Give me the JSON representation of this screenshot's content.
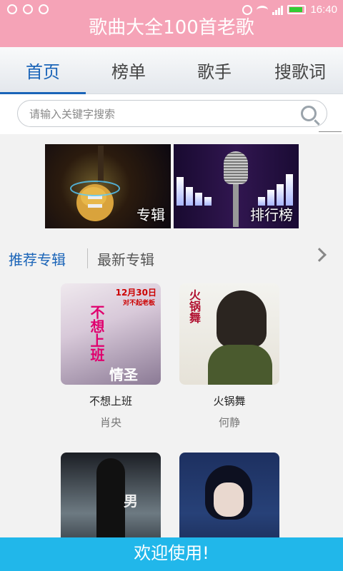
{
  "status_bar": {
    "time": "16:40"
  },
  "app": {
    "title": "歌曲大全100首老歌"
  },
  "tabs": [
    {
      "label": "首页",
      "active": true
    },
    {
      "label": "榜单",
      "active": false
    },
    {
      "label": "歌手",
      "active": false
    },
    {
      "label": "搜歌词",
      "active": false
    }
  ],
  "search": {
    "placeholder": "请输入关键字搜索",
    "value": ""
  },
  "banners": [
    {
      "label": "专辑",
      "icon": "guitar-image"
    },
    {
      "label": "排行榜",
      "icon": "microphone-image"
    }
  ],
  "album_tabs": {
    "recommended": "推荐专辑",
    "newest": "最新专辑"
  },
  "albums": [
    {
      "title": "不想上班",
      "artist": "肖央",
      "cover_text": [
        "12月30日",
        "对不起老板",
        "不想上班",
        "情圣"
      ]
    },
    {
      "title": "火锅舞",
      "artist": "何静",
      "cover_text": [
        "火锅舞"
      ]
    },
    {
      "title": "",
      "artist": "",
      "cover_text": [
        "男"
      ]
    },
    {
      "title": "",
      "artist": "",
      "cover_text": []
    }
  ],
  "footer": {
    "label": "欢迎使用!"
  },
  "colors": {
    "brand_pink": "#f5a3b7",
    "accent_blue": "#1a64b8",
    "footer_cyan": "#21b7ea"
  }
}
